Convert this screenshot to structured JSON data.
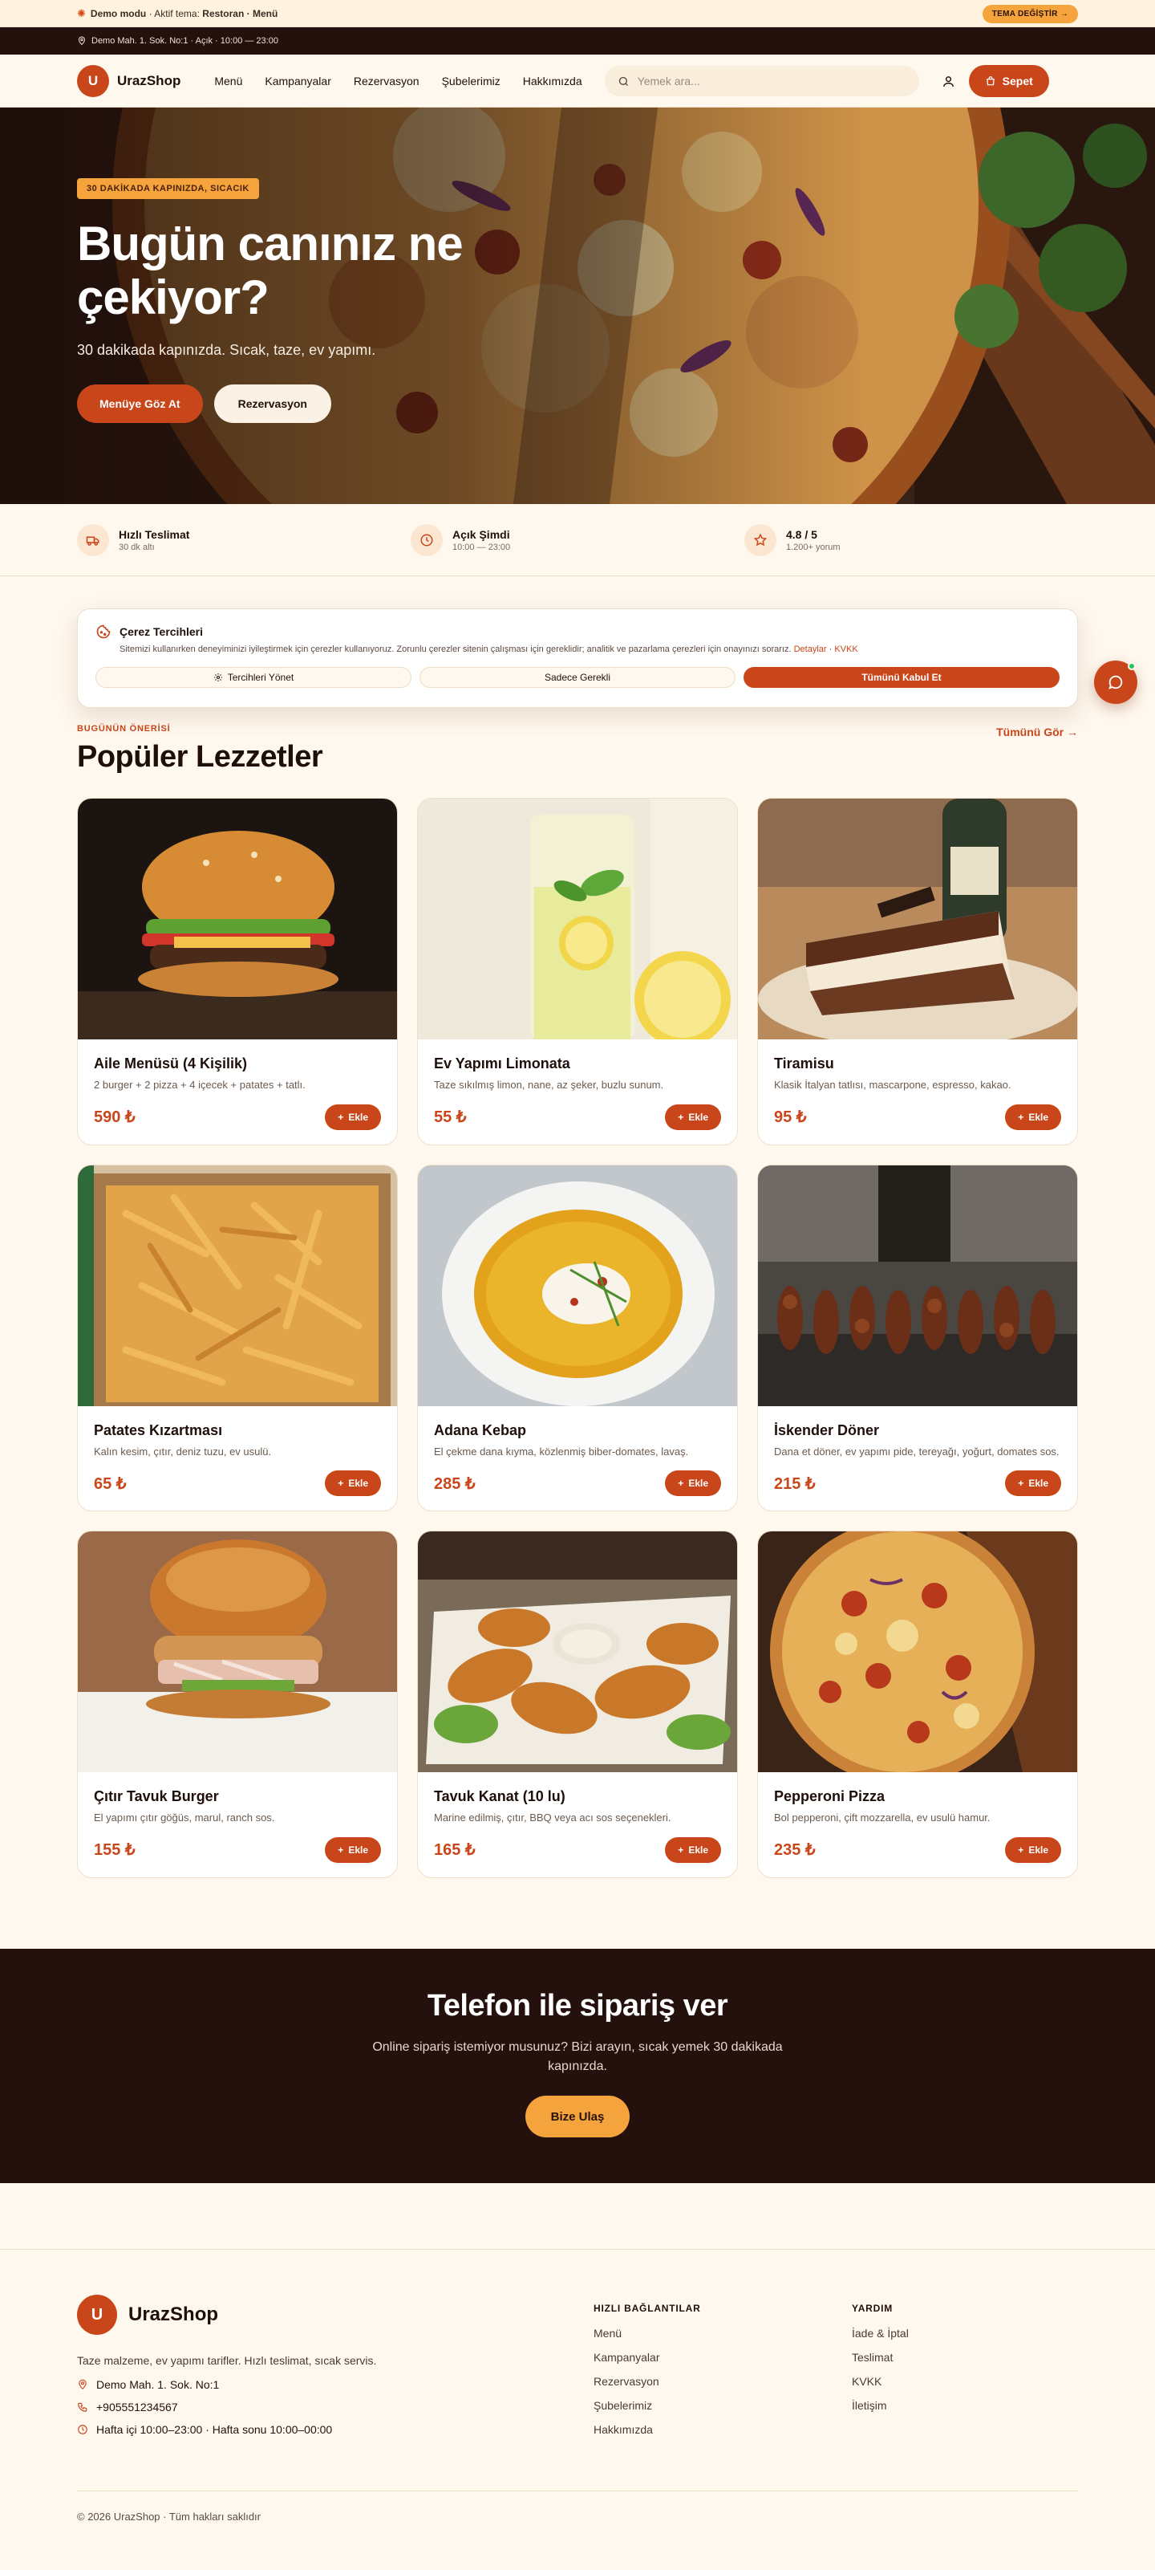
{
  "demo": {
    "prefix": "Demo modu",
    "mid": " · Aktif tema: ",
    "theme": "Restoran · Menü",
    "button": "TEMA DEĞİŞTİR →"
  },
  "info": {
    "text": "Demo Mah. 1. Sok. No:1  ·  Açık · 10:00 — 23:00"
  },
  "header": {
    "logo_letter": "U",
    "brand": "UrazShop",
    "nav": [
      "Menü",
      "Kampanyalar",
      "Rezervasyon",
      "Şubelerimiz",
      "Hakkımızda"
    ],
    "search_placeholder": "Yemek ara...",
    "cart": "Sepet"
  },
  "hero": {
    "badge": "30 DAKİKADA KAPINIZDA, SICACIK",
    "title_line1": "Bugün canınız ne",
    "title_line2": "çekiyor?",
    "subtitle": "30 dakikada kapınızda. Sıcak, taze, ev yapımı.",
    "btn_menu": "Menüye Göz At",
    "btn_reserve": "Rezervasyon"
  },
  "features": [
    {
      "title": "Hızlı Teslimat",
      "sub": "30 dk altı",
      "icon": "truck-icon"
    },
    {
      "title": "Açık Şimdi",
      "sub": "10:00 — 23:00",
      "icon": "clock-icon"
    },
    {
      "title": "4.8 / 5",
      "sub": "1.200+ yorum",
      "icon": "star-icon"
    }
  ],
  "cookie": {
    "title": "Çerez Tercihleri",
    "text": "Sitemizi kullanırken deneyiminizi iyileştirmek için çerezler kullanıyoruz. Zorunlu çerezler sitenin çalışması için gereklidir; analitik ve pazarlama çerezleri için onayınızı sorarız.",
    "link1": "Detaylar",
    "sep": " · ",
    "link2": "KVKK",
    "btn_manage": "Tercihleri Yönet",
    "btn_required": "Sadece Gerekli",
    "btn_accept": "Tümünü Kabul Et"
  },
  "section": {
    "eyebrow": "BUGÜNÜN ÖNERİSİ",
    "title": "Popüler Lezzetler",
    "see_all": "Tümünü Gör →"
  },
  "add_label": "Ekle",
  "products": [
    {
      "name": "Aile Menüsü (4 Kişilik)",
      "desc": "2 burger + 2 pizza + 4 içecek + patates + tatlı.",
      "price": "590 ₺"
    },
    {
      "name": "Ev Yapımı Limonata",
      "desc": "Taze sıkılmış limon, nane, az şeker, buzlu sunum.",
      "price": "55 ₺"
    },
    {
      "name": "Tiramisu",
      "desc": "Klasik İtalyan tatlısı, mascarpone, espresso, kakao.",
      "price": "95 ₺"
    },
    {
      "name": "Patates Kızartması",
      "desc": "Kalın kesim, çıtır, deniz tuzu, ev usulü.",
      "price": "65 ₺"
    },
    {
      "name": "Adana Kebap",
      "desc": "El çekme dana kıyma, közlenmiş biber-domates, lavaş.",
      "price": "285 ₺"
    },
    {
      "name": "İskender Döner",
      "desc": "Dana et döner, ev yapımı pide, tereyağı, yoğurt, domates sos.",
      "price": "215 ₺"
    },
    {
      "name": "Çıtır Tavuk Burger",
      "desc": "El yapımı çıtır göğüs, marul, ranch sos.",
      "price": "155 ₺"
    },
    {
      "name": "Tavuk Kanat (10 lu)",
      "desc": "Marine edilmiş, çıtır, BBQ veya acı sos seçenekleri.",
      "price": "165 ₺"
    },
    {
      "name": "Pepperoni Pizza",
      "desc": "Bol pepperoni, çift mozzarella, ev usulü hamur.",
      "price": "235 ₺"
    }
  ],
  "cta": {
    "title": "Telefon ile sipariş ver",
    "subtitle": "Online sipariş istemiyor musunuz? Bizi arayın, sıcak yemek 30 dakikada kapınızda.",
    "button": "Bize Ulaş"
  },
  "footer": {
    "tagline": "Taze malzeme, ev yapımı tarifler. Hızlı teslimat, sıcak servis.",
    "address": "Demo Mah. 1. Sok. No:1",
    "phone": "+905551234567",
    "hours": "Hafta içi 10:00–23:00 · Hafta sonu 10:00–00:00",
    "col1_title": "HIZLI BAĞLANTILAR",
    "col1_links": [
      "Menü",
      "Kampanyalar",
      "Rezervasyon",
      "Şubelerimiz",
      "Hakkımızda"
    ],
    "col2_title": "YARDIM",
    "col2_links": [
      "İade & İptal",
      "Teslimat",
      "KVKK",
      "İletişim"
    ],
    "copyright": "© 2026 UrazShop · Tüm hakları saklıdır"
  },
  "colors": {
    "accent": "#c9461b",
    "dark": "#24100c",
    "amber": "#f5a33c",
    "cream": "#fff8ee"
  }
}
